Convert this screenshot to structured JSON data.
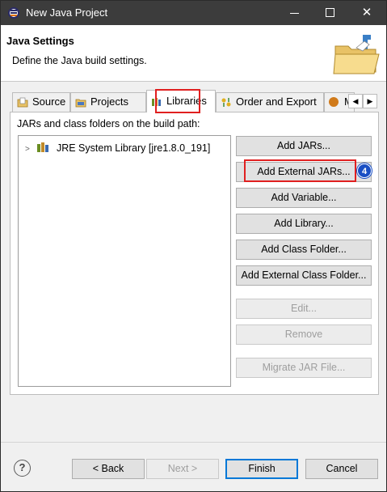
{
  "window": {
    "title": "New Java Project"
  },
  "header": {
    "title": "Java Settings",
    "description": "Define the Java build settings."
  },
  "tabs": [
    {
      "label": "Source"
    },
    {
      "label": "Projects"
    },
    {
      "label": "Libraries",
      "selected": true
    },
    {
      "label": "Order and Export"
    },
    {
      "label": "M"
    }
  ],
  "libraries": {
    "label": "JARs and class folders on the build path:",
    "tree": [
      {
        "label": "JRE System Library [jre1.8.0_191]",
        "expanded": false
      }
    ],
    "buttons": {
      "add_jars": "Add JARs...",
      "add_external_jars": "Add External JARs...",
      "add_variable": "Add Variable...",
      "add_library": "Add Library...",
      "add_class_folder": "Add Class Folder...",
      "add_external_class_folder": "Add External Class Folder...",
      "edit": "Edit...",
      "remove": "Remove",
      "migrate_jar": "Migrate JAR File..."
    },
    "step_badge": "4"
  },
  "footer": {
    "help": "?",
    "back": "< Back",
    "next": "Next >",
    "finish": "Finish",
    "cancel": "Cancel"
  },
  "colors": {
    "titlebar": "#3c3c3c",
    "highlight": "#e02020",
    "badge": "#1a4fc4",
    "primary_border": "#0078d7"
  }
}
